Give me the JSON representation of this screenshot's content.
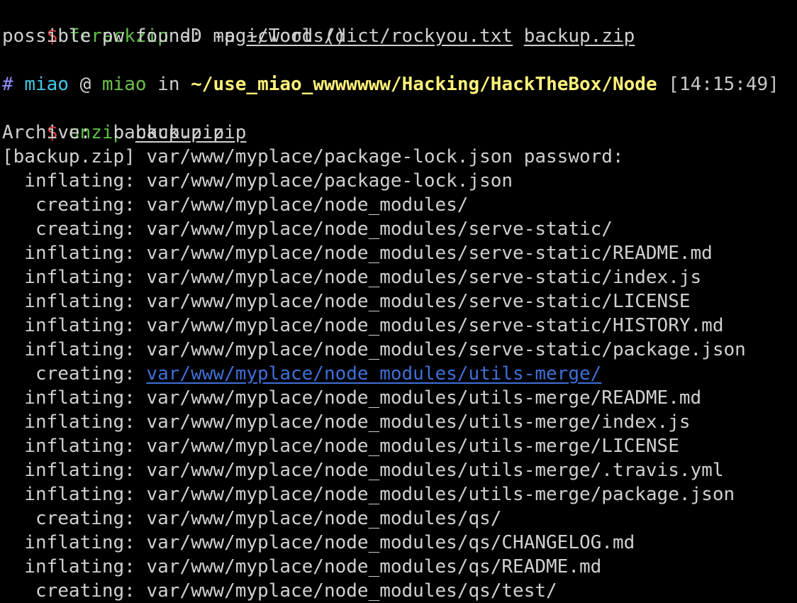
{
  "prompt1": {
    "dollar": "$",
    "command": "fcrackzip",
    "flags": " -D -p ",
    "arg1": "~/Tools/dict/rockyou.txt",
    "sep": " ",
    "arg2": "backup.zip"
  },
  "result_line": "possible pw found: magicword ()",
  "prompt_header": {
    "hash": "#",
    "user": "miao",
    "at": " @ ",
    "host": "miao",
    "in": " in ",
    "path": "~/use_miao_wwwwwww/Hacking/HackTheBox/Node",
    "time": " [14:15:49]"
  },
  "prompt2": {
    "dollar": "$",
    "command": "unzip",
    "sep": " ",
    "arg": "backup.zip"
  },
  "output": {
    "archive": "Archive:  backup.zip",
    "password_prompt": "[backup.zip] var/www/myplace/package-lock.json password: ",
    "lines": [
      {
        "action": "  inflating: ",
        "path": "var/www/myplace/package-lock.json",
        "link": false
      },
      {
        "action": "   creating: ",
        "path": "var/www/myplace/node_modules/",
        "link": false
      },
      {
        "action": "   creating: ",
        "path": "var/www/myplace/node_modules/serve-static/",
        "link": false
      },
      {
        "action": "  inflating: ",
        "path": "var/www/myplace/node_modules/serve-static/README.md",
        "link": false
      },
      {
        "action": "  inflating: ",
        "path": "var/www/myplace/node_modules/serve-static/index.js",
        "link": false
      },
      {
        "action": "  inflating: ",
        "path": "var/www/myplace/node_modules/serve-static/LICENSE",
        "link": false
      },
      {
        "action": "  inflating: ",
        "path": "var/www/myplace/node_modules/serve-static/HISTORY.md",
        "link": false
      },
      {
        "action": "  inflating: ",
        "path": "var/www/myplace/node_modules/serve-static/package.json",
        "link": false
      },
      {
        "action": "   creating: ",
        "path": "var/www/myplace/node_modules/utils-merge/",
        "link": true
      },
      {
        "action": "  inflating: ",
        "path": "var/www/myplace/node_modules/utils-merge/README.md",
        "link": false
      },
      {
        "action": "  inflating: ",
        "path": "var/www/myplace/node_modules/utils-merge/index.js",
        "link": false
      },
      {
        "action": "  inflating: ",
        "path": "var/www/myplace/node_modules/utils-merge/LICENSE",
        "link": false
      },
      {
        "action": "  inflating: ",
        "path": "var/www/myplace/node_modules/utils-merge/.travis.yml",
        "link": false
      },
      {
        "action": "  inflating: ",
        "path": "var/www/myplace/node_modules/utils-merge/package.json",
        "link": false
      },
      {
        "action": "   creating: ",
        "path": "var/www/myplace/node_modules/qs/",
        "link": false
      },
      {
        "action": "  inflating: ",
        "path": "var/www/myplace/node_modules/qs/CHANGELOG.md",
        "link": false
      },
      {
        "action": "  inflating: ",
        "path": "var/www/myplace/node_modules/qs/README.md",
        "link": false
      },
      {
        "action": "   creating: ",
        "path": "var/www/myplace/node_modules/qs/test/",
        "link": false
      }
    ]
  },
  "colors": {
    "background": "#000000",
    "text": "#d0d0d0",
    "prompt_dollar": "#ee4b4b",
    "command": "#5fbf4a",
    "hash": "#8f8fff",
    "user": "#40c8e6",
    "host": "#6ec24c",
    "path": "#fff27a",
    "link": "#3f6fd8"
  }
}
